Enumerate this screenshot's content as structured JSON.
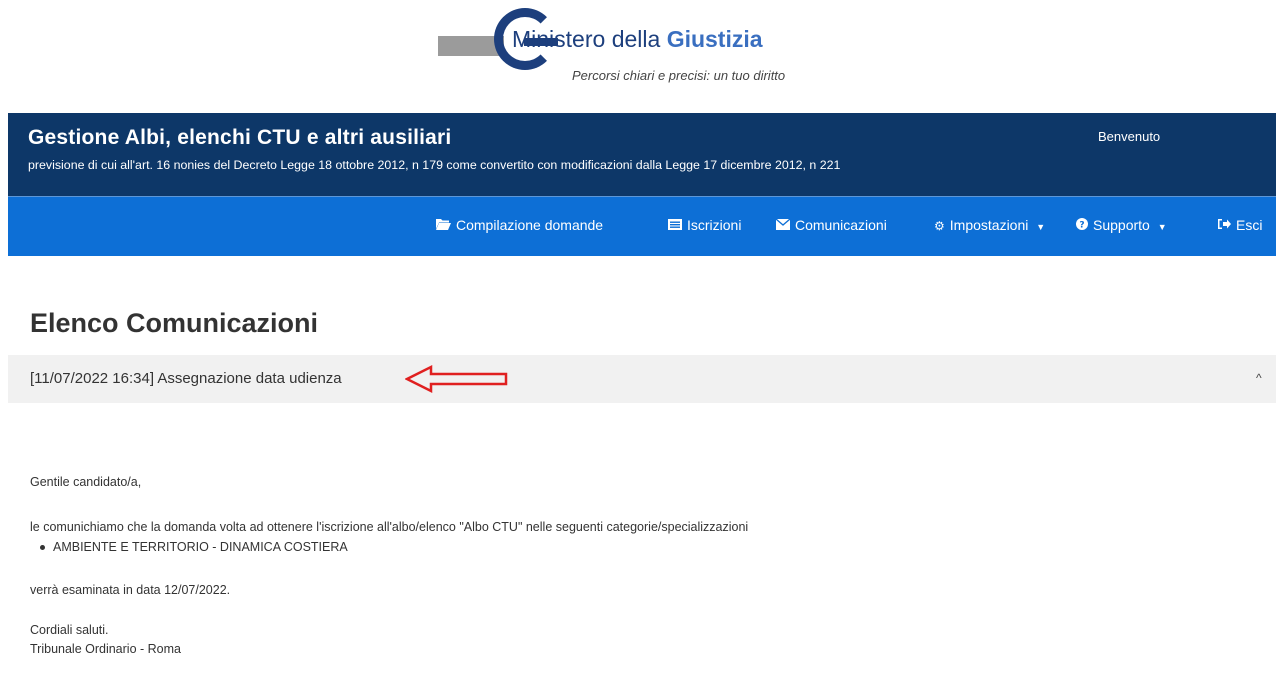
{
  "logo": {
    "name_part1": "Ministero della",
    "name_part2": "Giustizia",
    "tagline": "Percorsi chiari e precisi: un tuo diritto"
  },
  "header": {
    "title": "Gestione Albi, elenchi CTU e altri ausiliari",
    "subtitle": "previsione di cui all'art. 16 nonies del Decreto Legge 18 ottobre 2012, n 179 come convertito con modificazioni dalla Legge 17 dicembre 2012, n 221",
    "welcome": "Benvenuto"
  },
  "nav": {
    "items": [
      {
        "label": "Compilazione domande",
        "icon": "folder-open-icon"
      },
      {
        "label": "Iscrizioni",
        "icon": "list-icon"
      },
      {
        "label": "Comunicazioni",
        "icon": "envelope-icon"
      },
      {
        "label": "Impostazioni",
        "icon": "gear-icon",
        "dropdown": true
      },
      {
        "label": "Supporto",
        "icon": "question-circle-icon",
        "dropdown": true
      },
      {
        "label": "Esci",
        "icon": "sign-out-icon"
      }
    ]
  },
  "page": {
    "title": "Elenco Comunicazioni"
  },
  "communication": {
    "header": "[11/07/2022 16:34] Assegnazione data udienza",
    "greeting": "Gentile candidato/a,",
    "intro": "le comunichiamo che la domanda volta ad ottenere l'iscrizione all'albo/elenco \"Albo CTU\" nelle seguenti categorie/specializzazioni",
    "categories": [
      "AMBIENTE E TERRITORIO - DINAMICA COSTIERA"
    ],
    "date_line": "verrà esaminata in data 12/07/2022.",
    "closing": "Cordiali saluti.",
    "signature": "Tribunale Ordinario - Roma"
  },
  "colors": {
    "header_bg": "#0d3768",
    "navbar_bg": "#0d6fd6",
    "annotation_arrow": "#e02020"
  }
}
